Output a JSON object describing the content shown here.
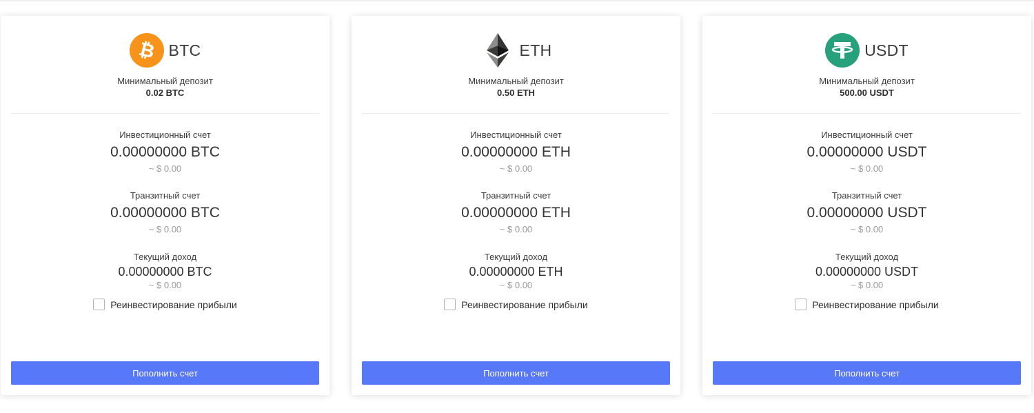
{
  "common": {
    "min_deposit_label": "Минимальный депозит",
    "invest_label": "Инвестиционный счет",
    "transit_label": "Транзитный счет",
    "income_label": "Текущий доход",
    "reinvest_label": "Реинвестирование прибыли",
    "deposit_button": "Пополнить счет"
  },
  "cards": [
    {
      "coin": "BTC",
      "icon": "bitcoin-icon",
      "icon_color": "#f7931a",
      "min_deposit": "0.02 BTC",
      "invest_amount": "0.00000000 BTC",
      "invest_usd": "~ $ 0.00",
      "transit_amount": "0.00000000 BTC",
      "transit_usd": "~ $ 0.00",
      "income_amount": "0.00000000 BTC",
      "income_usd": "~ $ 0.00",
      "reinvest_checked": false
    },
    {
      "coin": "ETH",
      "icon": "ethereum-icon",
      "icon_color": "#343434",
      "min_deposit": "0.50 ETH",
      "invest_amount": "0.00000000 ETH",
      "invest_usd": "~ $ 0.00",
      "transit_amount": "0.00000000 ETH",
      "transit_usd": "~ $ 0.00",
      "income_amount": "0.00000000 ETH",
      "income_usd": "~ $ 0.00",
      "reinvest_checked": false
    },
    {
      "coin": "USDT",
      "icon": "tether-icon",
      "icon_color": "#26a17b",
      "min_deposit": "500.00 USDT",
      "invest_amount": "0.00000000 USDT",
      "invest_usd": "~ $ 0.00",
      "transit_amount": "0.00000000 USDT",
      "transit_usd": "~ $ 0.00",
      "income_amount": "0.00000000 USDT",
      "income_usd": "~ $ 0.00",
      "reinvest_checked": false
    }
  ],
  "colors": {
    "button_bg": "#5878fa",
    "button_text": "#ffffff",
    "muted_text": "#9a9a9a"
  }
}
